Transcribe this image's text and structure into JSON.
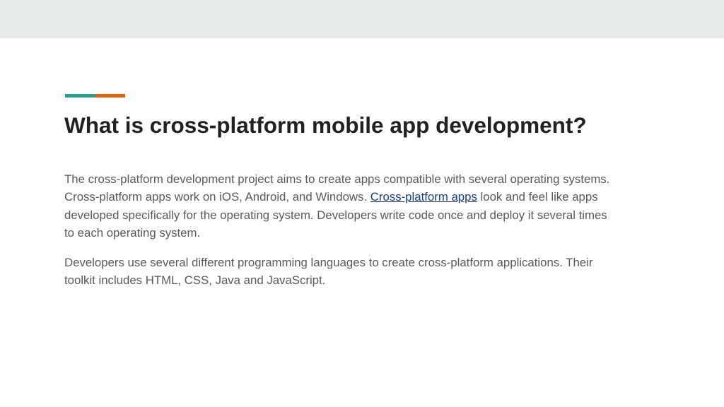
{
  "slide": {
    "title": "What is cross-platform mobile app development?",
    "paragraph1": {
      "line1": "The cross-platform development project aims to create apps compatible with several operating systems.",
      "line2_before_link": "Cross-platform apps work on iOS, Android, and Windows. ",
      "link_text": "Cross-platform apps",
      "line2_after_link": " look and feel like apps",
      "line3": "developed specifically for the operating system. Developers write code once and deploy it several times",
      "line4": "to each operating system."
    },
    "paragraph2": {
      "line1": "Developers use several different programming languages to create cross-platform applications. Their",
      "line2": "toolkit includes HTML, CSS, Java and JavaScript."
    }
  },
  "colors": {
    "top_band": "#e8ebec",
    "accent_teal": "#2a9d92",
    "accent_orange": "#e8600e",
    "title": "#212121",
    "body": "#595959",
    "link": "#1a3a8a"
  }
}
